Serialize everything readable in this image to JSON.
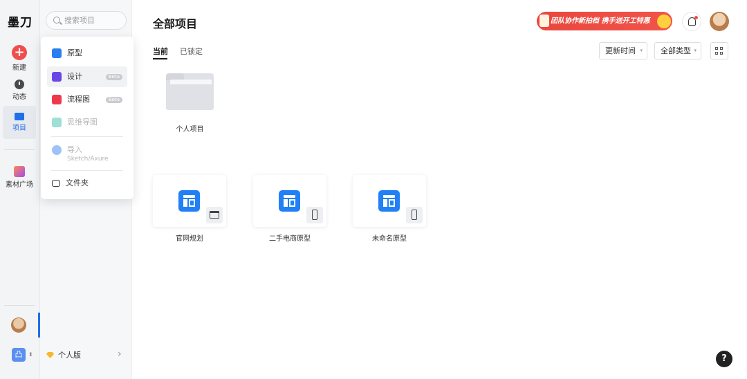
{
  "app": {
    "logo": "墨刀"
  },
  "rail": {
    "items": [
      {
        "label": "新建",
        "icon": "plus-icon"
      },
      {
        "label": "动态",
        "icon": "clock-icon"
      },
      {
        "label": "项目",
        "icon": "folder-icon",
        "active": true
      },
      {
        "label": "素材广场",
        "icon": "material-icon"
      }
    ],
    "team_icon_text": "凸"
  },
  "panel": {
    "search_placeholder": "搜索项目",
    "plan_label": "个人版",
    "plan_arrow": "›"
  },
  "dropdown": {
    "items": [
      {
        "label": "原型",
        "color": "#2a7ef0"
      },
      {
        "label": "设计",
        "badge": "Beta",
        "color": "#6b46e6"
      },
      {
        "label": "流程图",
        "badge": "Beta",
        "color": "#f0384d"
      },
      {
        "label": "思维导图",
        "disabled": true,
        "color": "#9ee0d6"
      },
      {
        "label": "导入",
        "sublabel": "Sketch/Axure",
        "disabled": true,
        "color": "#9cc2f7"
      },
      {
        "label": "文件夹"
      }
    ]
  },
  "main": {
    "title": "全部项目",
    "banner_text": "团队协作新拍档 携手送开工特惠",
    "tabs": [
      {
        "label": "当前",
        "active": true
      },
      {
        "label": "已锁定"
      }
    ],
    "filters": {
      "sort": "更新时间",
      "type": "全部类型",
      "caret": "▾"
    },
    "folder": {
      "label": "个人项目"
    },
    "projects": [
      {
        "name": "官网规划",
        "device": "desktop"
      },
      {
        "name": "二手电商原型",
        "device": "phone"
      },
      {
        "name": "未命名原型",
        "device": "phone"
      }
    ],
    "help_label": "?"
  }
}
